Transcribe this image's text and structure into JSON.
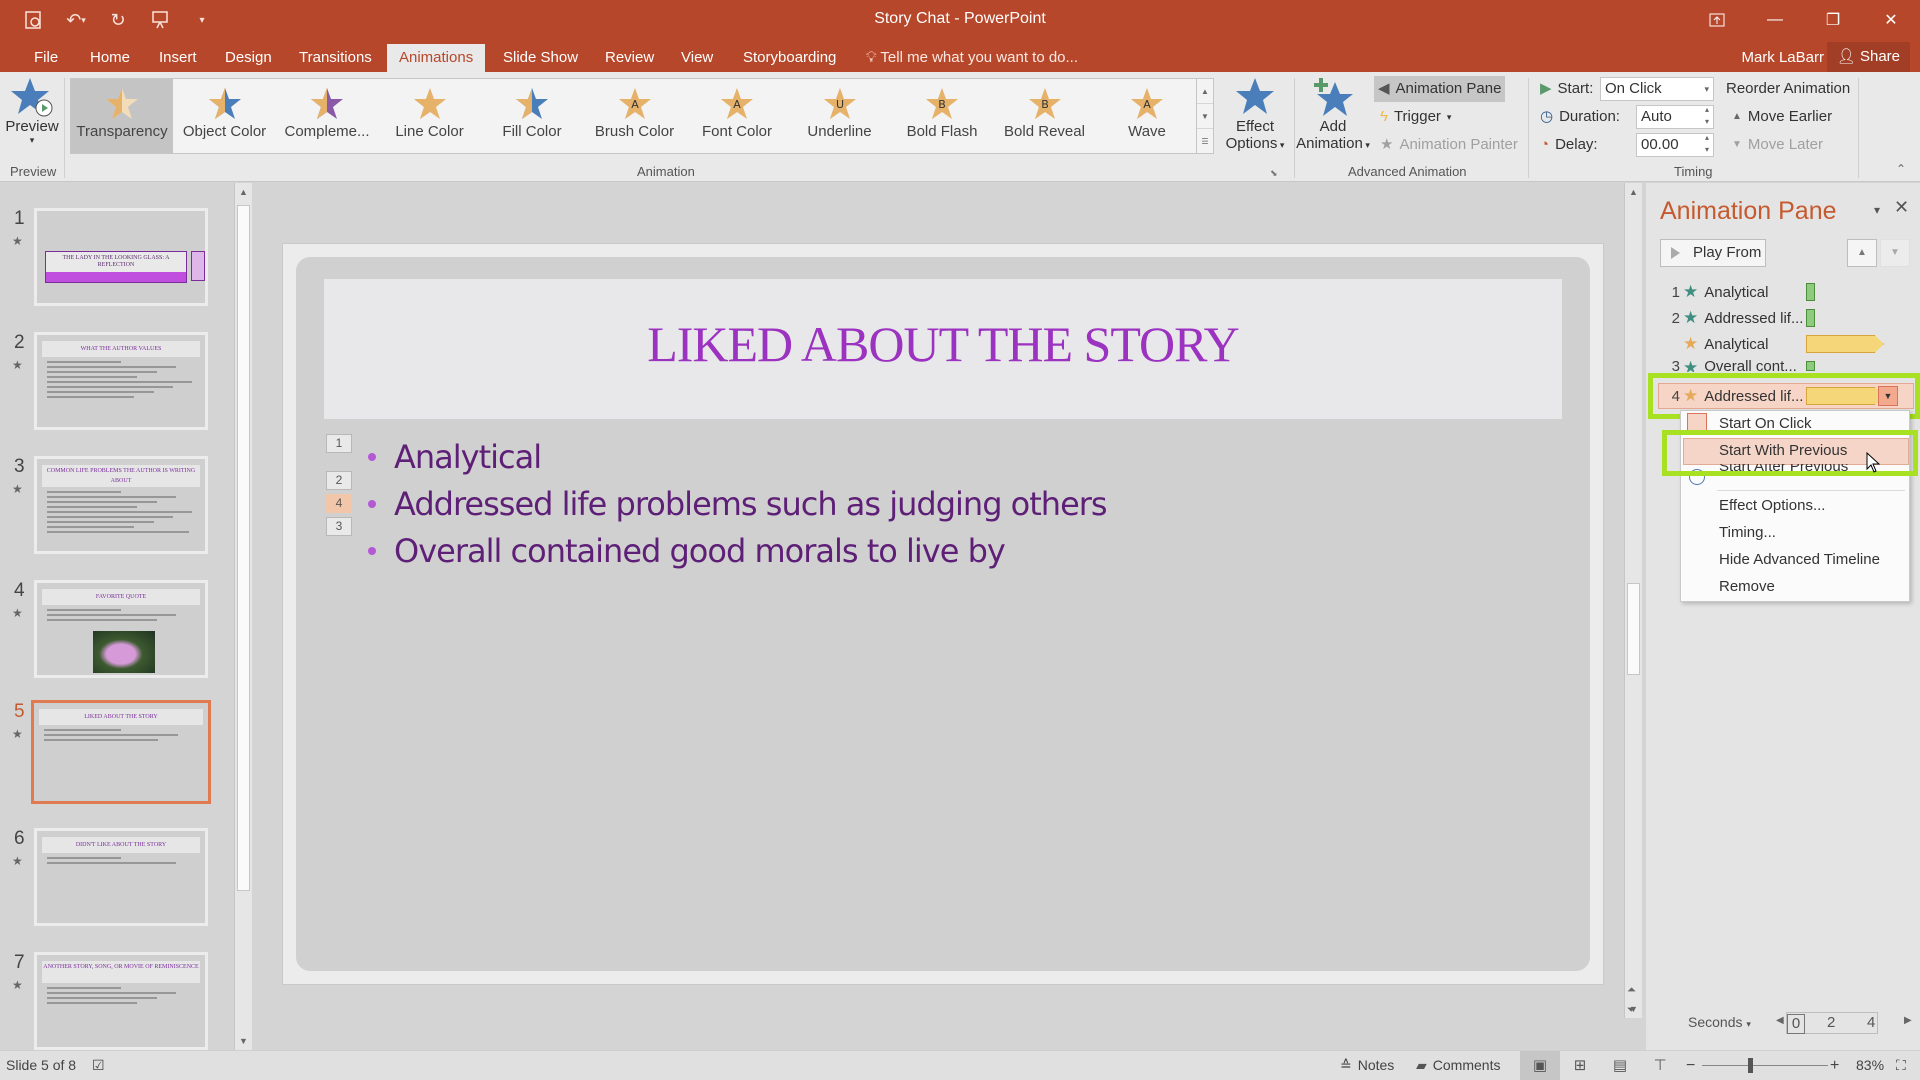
{
  "app": {
    "window_title": "Story Chat - PowerPoint",
    "user_name": "Mark LaBarr",
    "share_label": "Share",
    "brand_color": "#b7472a"
  },
  "qat": {
    "icons": [
      "save-icon",
      "undo-icon",
      "redo-icon",
      "present-from-start-icon",
      "customize-qat-icon"
    ]
  },
  "tabs": [
    {
      "label": "File"
    },
    {
      "label": "Home"
    },
    {
      "label": "Insert"
    },
    {
      "label": "Design"
    },
    {
      "label": "Transitions"
    },
    {
      "label": "Animations",
      "active": true
    },
    {
      "label": "Slide Show"
    },
    {
      "label": "Review"
    },
    {
      "label": "View"
    },
    {
      "label": "Storyboarding"
    }
  ],
  "tell_me": "Tell me what you want to do...",
  "ribbon": {
    "preview_label": "Preview",
    "preview_group": "Preview",
    "animation_group": "Animation",
    "gallery": [
      {
        "label": "Transparency",
        "selected": true
      },
      {
        "label": "Object Color"
      },
      {
        "label": "Compleme..."
      },
      {
        "label": "Line Color"
      },
      {
        "label": "Fill Color"
      },
      {
        "label": "Brush Color"
      },
      {
        "label": "Font Color"
      },
      {
        "label": "Underline"
      },
      {
        "label": "Bold Flash"
      },
      {
        "label": "Bold Reveal"
      },
      {
        "label": "Wave"
      }
    ],
    "effect_options_line1": "Effect",
    "effect_options_line2": "Options",
    "add_animation_line1": "Add",
    "add_animation_line2": "Animation",
    "animation_pane_label": "Animation Pane",
    "trigger_label": "Trigger",
    "animation_painter_label": "Animation Painter",
    "advanced_group": "Advanced Animation",
    "timing": {
      "start_label": "Start:",
      "start_value": "On Click",
      "duration_label": "Duration:",
      "duration_value": "Auto",
      "delay_label": "Delay:",
      "delay_value": "00.00",
      "reorder_label": "Reorder Animation",
      "move_earlier": "Move Earlier",
      "move_later": "Move Later",
      "group": "Timing"
    }
  },
  "slides": [
    {
      "num": "1",
      "title": "THE LADY IN THE LOOKING GLASS: A REFLECTION"
    },
    {
      "num": "2",
      "title": "WHAT THE AUTHOR VALUES"
    },
    {
      "num": "3",
      "title": "COMMON LIFE PROBLEMS THE AUTHOR IS WRITING ABOUT"
    },
    {
      "num": "4",
      "title": "FAVORITE QUOTE"
    },
    {
      "num": "5",
      "title": "LIKED ABOUT THE STORY",
      "selected": true
    },
    {
      "num": "6",
      "title": "DIDN'T LIKE ABOUT THE STORY"
    },
    {
      "num": "7",
      "title": "ANOTHER STORY, SONG, OR MOVIE OF REMINISCENCE"
    }
  ],
  "current_slide": {
    "title": "LIKED ABOUT THE STORY",
    "bullets": [
      "Analytical",
      "Addressed life problems such as judging others",
      "Overall contained good morals to live by"
    ],
    "anim_tags": [
      "1",
      "2",
      "4",
      "3"
    ]
  },
  "animation_pane": {
    "title": "Animation Pane",
    "play_from": "Play From",
    "items": [
      {
        "num": "1",
        "name": "Analytical",
        "type": "on-click"
      },
      {
        "num": "2",
        "name": "Addressed lif...",
        "type": "on-click"
      },
      {
        "num": "",
        "name": "Analytical",
        "type": "with-previous"
      },
      {
        "num": "3",
        "name": "Overall cont...",
        "type": "on-click"
      },
      {
        "num": "4",
        "name": "Addressed lif...",
        "type": "on-click",
        "selected": true
      }
    ],
    "context_menu": [
      {
        "label": "Start On Click"
      },
      {
        "label": "Start With Previous",
        "hovered": true
      },
      {
        "label": "Start After Previous"
      },
      {
        "label": "Effect Options..."
      },
      {
        "label": "Timing..."
      },
      {
        "label": "Hide Advanced Timeline"
      },
      {
        "label": "Remove"
      }
    ],
    "seconds_label": "Seconds",
    "timeline_ticks": [
      "0",
      "2",
      "4"
    ],
    "highlight_color": "#a8e022"
  },
  "status": {
    "slide_info": "Slide 5 of 8",
    "notes": "Notes",
    "comments": "Comments",
    "zoom": "83%"
  }
}
